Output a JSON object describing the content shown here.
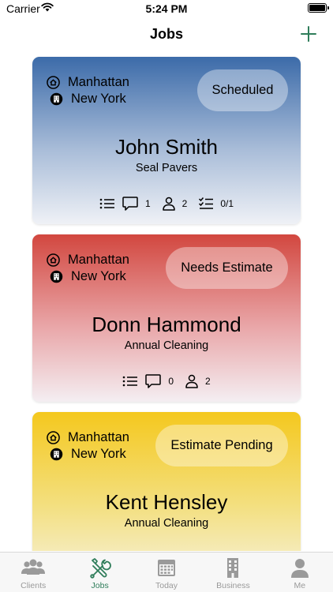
{
  "status_bar": {
    "carrier": "Carrier",
    "time": "5:24 PM"
  },
  "nav": {
    "title": "Jobs"
  },
  "colors": {
    "accent": "#2f7d5a",
    "scheduled": "#3c6ba9",
    "needs_estimate": "#d2473f",
    "estimate_pending": "#f4c81e",
    "tab_inactive": "#9a9a9a"
  },
  "jobs": [
    {
      "borough": "Manhattan",
      "city": "New York",
      "status": "Scheduled",
      "client": "John  Smith",
      "service": "Seal Pavers",
      "comments": "1",
      "people": "2",
      "checklist": "0/1"
    },
    {
      "borough": "Manhattan",
      "city": "New York",
      "status": "Needs Estimate",
      "client": "Donn Hammond",
      "service": "Annual Cleaning",
      "comments": "0",
      "people": "2"
    },
    {
      "borough": "Manhattan",
      "city": "New York",
      "status": "Estimate Pending",
      "client": "Kent Hensley",
      "service": "Annual Cleaning"
    }
  ],
  "tabs": [
    {
      "label": "Clients",
      "icon": "clients-icon",
      "active": false
    },
    {
      "label": "Jobs",
      "icon": "tools-icon",
      "active": true
    },
    {
      "label": "Today",
      "icon": "calendar-icon",
      "active": false
    },
    {
      "label": "Business",
      "icon": "building-icon",
      "active": false
    },
    {
      "label": "Me",
      "icon": "person-icon",
      "active": false
    }
  ]
}
